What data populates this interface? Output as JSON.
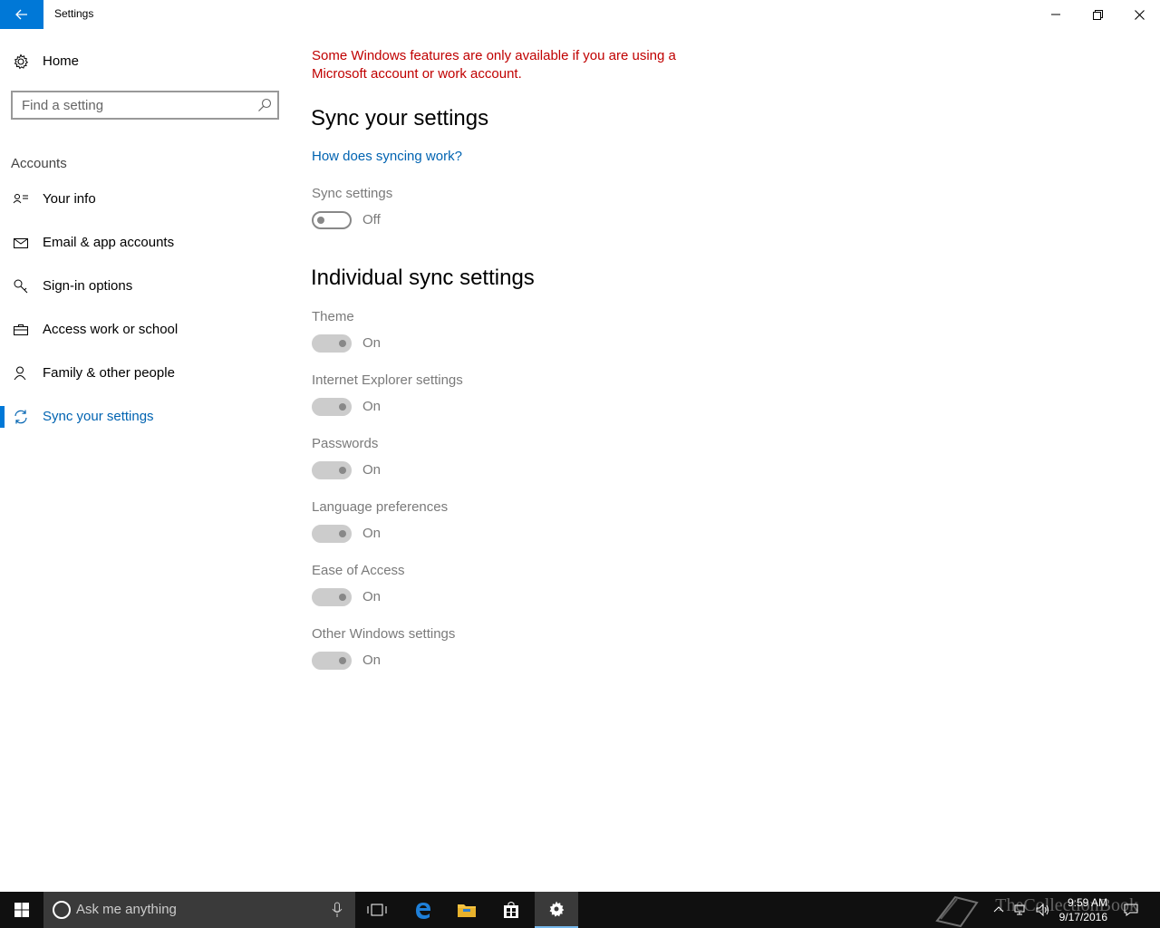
{
  "window": {
    "title": "Settings"
  },
  "sidebar": {
    "home_label": "Home",
    "search_placeholder": "Find a setting",
    "group_label": "Accounts",
    "items": [
      {
        "label": "Your info",
        "icon": "person-card-icon"
      },
      {
        "label": "Email & app accounts",
        "icon": "mail-icon"
      },
      {
        "label": "Sign-in options",
        "icon": "key-icon"
      },
      {
        "label": "Access work or school",
        "icon": "briefcase-icon"
      },
      {
        "label": "Family & other people",
        "icon": "person-add-icon"
      },
      {
        "label": "Sync your settings",
        "icon": "sync-icon",
        "active": true
      }
    ]
  },
  "main": {
    "warning": "Some Windows features are only available if you are using a Microsoft account or work account.",
    "heading1": "Sync your settings",
    "help_link": "How does syncing work?",
    "sync_settings": {
      "label": "Sync settings",
      "state": "Off"
    },
    "heading2": "Individual sync settings",
    "individual": [
      {
        "label": "Theme",
        "state": "On"
      },
      {
        "label": "Internet Explorer settings",
        "state": "On"
      },
      {
        "label": "Passwords",
        "state": "On"
      },
      {
        "label": "Language preferences",
        "state": "On"
      },
      {
        "label": "Ease of Access",
        "state": "On"
      },
      {
        "label": "Other Windows settings",
        "state": "On"
      }
    ]
  },
  "taskbar": {
    "search_text": "Ask me anything",
    "time": "9:59 AM",
    "date": "9/17/2016",
    "watermark": "TheCollectionBook"
  },
  "colors": {
    "accent": "#0078d7",
    "warning": "#c00000",
    "link": "#0063b1",
    "taskbar": "#101010"
  }
}
